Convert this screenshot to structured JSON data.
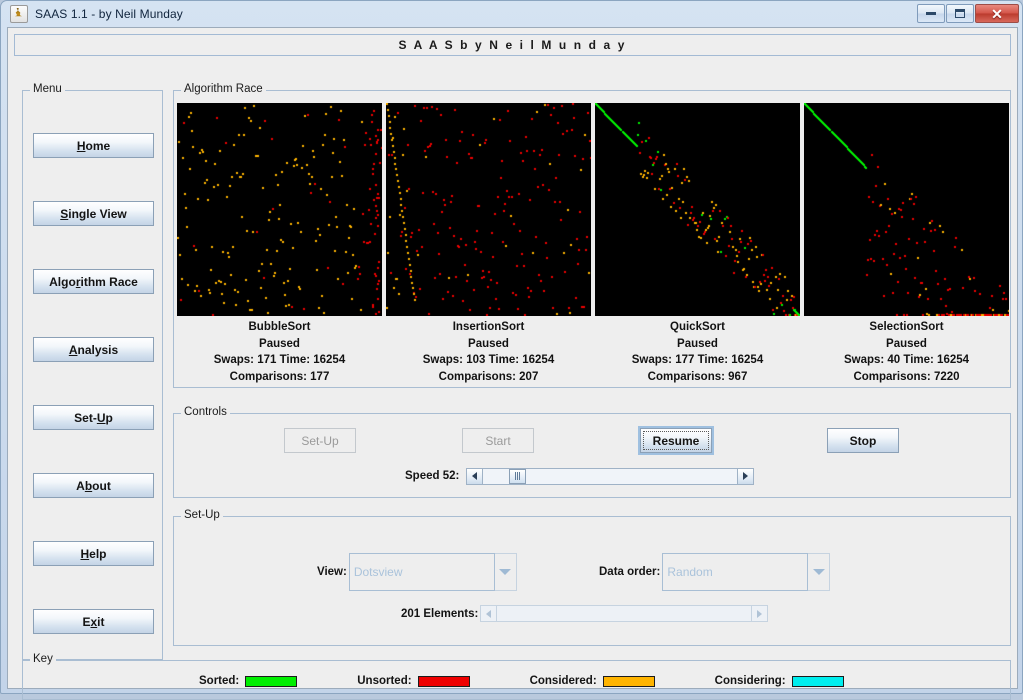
{
  "window": {
    "title": "SAAS 1.1 - by Neil Munday",
    "icon": "java-coffee-cup-icon",
    "minimize": "–",
    "maximize": "□",
    "close": "✕"
  },
  "banner": {
    "text": "S A A S   b y   N e i l   M u n d a y"
  },
  "sidebar": {
    "title": "Menu",
    "items": [
      {
        "label": "Home",
        "mnemonic": "H"
      },
      {
        "label": "Single View",
        "mnemonic": "S"
      },
      {
        "label": "Algorithm Race",
        "mnemonic": "r"
      },
      {
        "label": "Analysis",
        "mnemonic": "A"
      },
      {
        "label": "Set-Up",
        "mnemonic": "U"
      },
      {
        "label": "About",
        "mnemonic": "b"
      },
      {
        "label": "Help",
        "mnemonic": "H"
      },
      {
        "label": "Exit",
        "mnemonic": "x"
      }
    ]
  },
  "race": {
    "title": "Algorithm Race",
    "algorithms": [
      {
        "name": "BubbleSort",
        "status": "Paused",
        "swaps_time": "Swaps: 171  Time: 16254",
        "comparisons": "Comparisons: 177",
        "swaps": 171,
        "time": 16254,
        "comparison_count": 177
      },
      {
        "name": "InsertionSort",
        "status": "Paused",
        "swaps_time": "Swaps: 103  Time: 16254",
        "comparisons": "Comparisons: 207",
        "swaps": 103,
        "time": 16254,
        "comparison_count": 207
      },
      {
        "name": "QuickSort",
        "status": "Paused",
        "swaps_time": "Swaps: 177  Time: 16254",
        "comparisons": "Comparisons: 967",
        "swaps": 177,
        "time": 16254,
        "comparison_count": 967
      },
      {
        "name": "SelectionSort",
        "status": "Paused",
        "swaps_time": "Swaps: 40  Time: 16254",
        "comparisons": "Comparisons: 7220",
        "swaps": 40,
        "time": 16254,
        "comparison_count": 7220
      }
    ]
  },
  "controls": {
    "title": "Controls",
    "buttons": [
      {
        "label": "Set-Up",
        "enabled": false,
        "focused": false
      },
      {
        "label": "Start",
        "enabled": false,
        "focused": false
      },
      {
        "label": "Resume",
        "enabled": true,
        "focused": true
      },
      {
        "label": "Stop",
        "enabled": true,
        "focused": false
      }
    ],
    "speed_label": "Speed 52:",
    "speed_value": 52
  },
  "setup": {
    "title": "Set-Up",
    "view_label": "View:",
    "view_value": "Dotsview",
    "data_order_label": "Data order:",
    "data_order_value": "Random",
    "elements_label": "201 Elements:",
    "elements_value": 201,
    "enabled": false
  },
  "key": {
    "title": "Key",
    "items": [
      {
        "label": "Sorted:",
        "color": "#00ee00"
      },
      {
        "label": "Unsorted:",
        "color": "#ee0000"
      },
      {
        "label": "Considered:",
        "color": "#ffb400"
      },
      {
        "label": "Considering:",
        "color": "#00eeee"
      }
    ]
  },
  "viz": {
    "palette": {
      "sorted": "#00ee00",
      "unsorted": "#ee0000",
      "considered": "#ffb400",
      "considering": "#00eeee",
      "background": "#000000"
    },
    "panels": [
      {
        "name": "BubbleSort",
        "scatter_dominant": "considered",
        "scatter_secondary": "unsorted",
        "sorted_line": "none",
        "edge_band": "right"
      },
      {
        "name": "InsertionSort",
        "scatter_dominant": "unsorted",
        "scatter_secondary": "considered",
        "sorted_line": "none",
        "edge_band": "left"
      },
      {
        "name": "QuickSort",
        "scatter_dominant": "considered",
        "scatter_secondary": "unsorted",
        "sorted_line": "diagonal-band",
        "edge_band": "none"
      },
      {
        "name": "SelectionSort",
        "scatter_dominant": "unsorted",
        "scatter_secondary": "considered",
        "sorted_line": "top-left-diagonal",
        "edge_band": "none"
      }
    ]
  }
}
